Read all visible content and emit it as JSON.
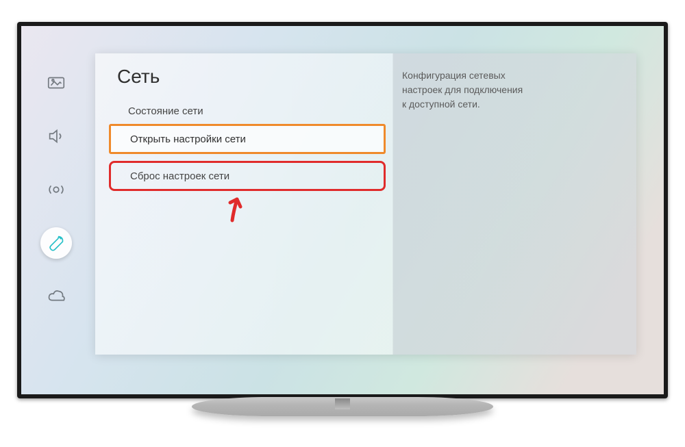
{
  "header": {
    "title": "Сеть"
  },
  "help": {
    "text": "Конфигурация сетевых\nнастроек для подключения\nк доступной сети."
  },
  "menu": {
    "status": "Состояние сети",
    "open_settings": "Открыть настройки сети",
    "reset_settings": "Сброс настроек сети"
  },
  "sidebar": {
    "items": [
      "picture",
      "sound",
      "broadcast",
      "general",
      "support"
    ]
  },
  "colors": {
    "accent": "#27c0c8",
    "highlight_orange": "#ef8a2b",
    "highlight_red": "#e02b2b"
  }
}
